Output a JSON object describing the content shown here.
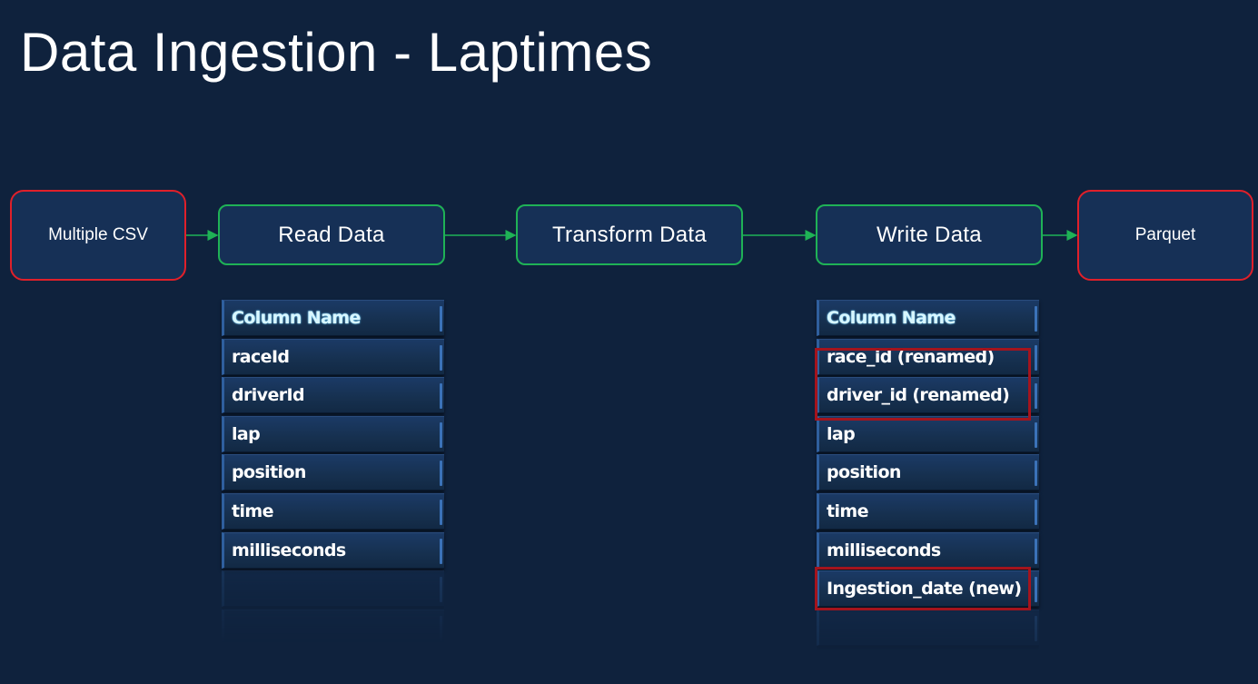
{
  "title": "Data Ingestion - Laptimes",
  "flow": {
    "source": "Multiple CSV",
    "read": "Read Data",
    "transform": "Transform Data",
    "write": "Write Data",
    "target": "Parquet"
  },
  "colors": {
    "background": "#0f223d",
    "box_fill": "#163056",
    "source_border": "#e0202a",
    "step_border": "#1fb256",
    "arrow": "#1fb256",
    "highlight": "#a4141d"
  },
  "read_table": {
    "header": "Column Name",
    "rows": [
      "raceId",
      "driverId",
      "lap",
      "position",
      "time",
      "milliseconds"
    ]
  },
  "write_table": {
    "header": "Column Name",
    "rows": [
      "race_id (renamed)",
      "driver_id (renamed)",
      "lap",
      "position",
      "time",
      "milliseconds",
      "Ingestion_date (new)"
    ]
  }
}
